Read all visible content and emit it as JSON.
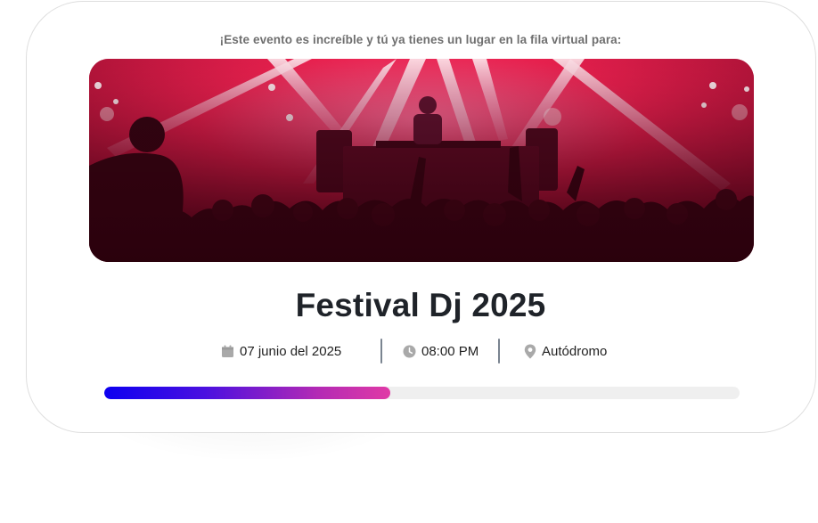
{
  "queue": {
    "intro_text": "¡Este evento es increíble y tú ya tienes un lugar en la fila virtual para:",
    "progress_fraction": 0.45
  },
  "event": {
    "image_alt": "Festival concert crowd with DJ on stage under pink lights",
    "title": "Festival Dj 2025",
    "date": "07 junio del 2025",
    "time": "08:00 PM",
    "location": "Autódromo"
  },
  "icons": {
    "date": "calendar-icon",
    "time": "clock-icon",
    "location": "location-pin-icon"
  },
  "colors": {
    "title": "#1f2329",
    "progress_start": "#0d00f0",
    "progress_end": "#e03aa6",
    "track": "#efefef"
  }
}
